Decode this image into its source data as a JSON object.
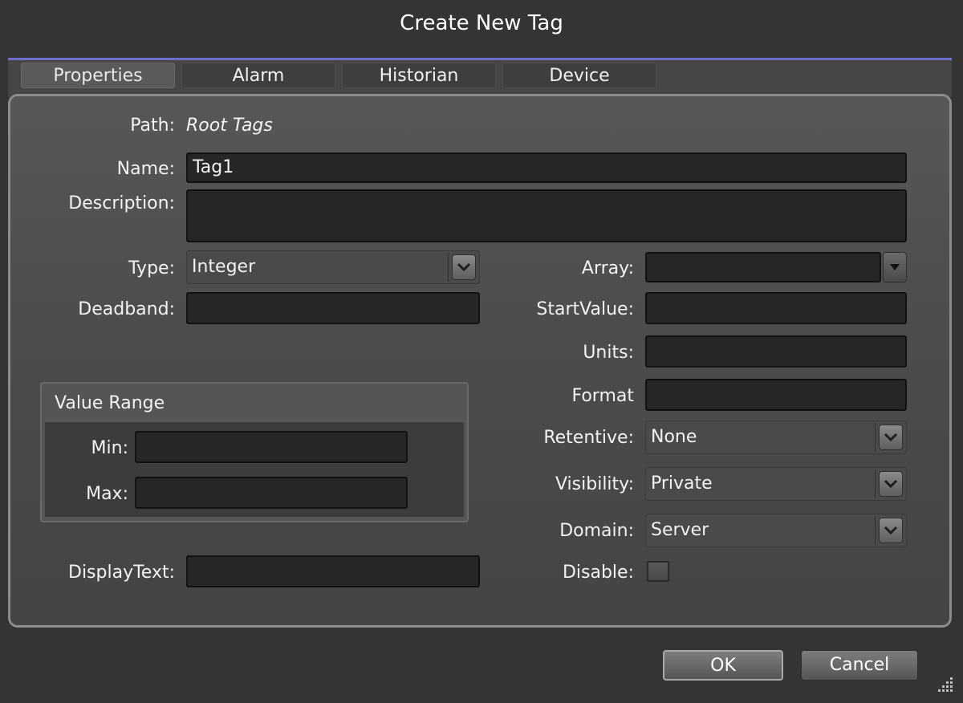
{
  "dialog": {
    "title": "Create New Tag"
  },
  "tabs": [
    "Properties",
    "Alarm",
    "Historian",
    "Device"
  ],
  "path": {
    "label": "Path:",
    "value": "Root Tags"
  },
  "name": {
    "label": "Name:",
    "value": "Tag1"
  },
  "description": {
    "label": "Description:",
    "value": ""
  },
  "type": {
    "label": "Type:",
    "value": "Integer"
  },
  "deadband": {
    "label": "Deadband:",
    "value": ""
  },
  "array": {
    "label": "Array:",
    "value": ""
  },
  "startvalue": {
    "label": "StartValue:",
    "value": ""
  },
  "units": {
    "label": "Units:",
    "value": ""
  },
  "format": {
    "label": "Format",
    "value": ""
  },
  "retentive": {
    "label": "Retentive:",
    "value": "None"
  },
  "visibility": {
    "label": "Visibility:",
    "value": "Private"
  },
  "domain": {
    "label": "Domain:",
    "value": "Server"
  },
  "disable": {
    "label": "Disable:",
    "checked": false
  },
  "value_range": {
    "title": "Value Range",
    "min_label": "Min:",
    "min_value": "",
    "max_label": "Max:",
    "max_value": ""
  },
  "displaytext": {
    "label": "DisplayText:",
    "value": ""
  },
  "buttons": {
    "ok": "OK",
    "cancel": "Cancel"
  },
  "colors": {
    "accent": "#6d6fd0",
    "background": "#343434",
    "input": "#262626"
  },
  "icons": {
    "dropdown": "chevron-down-icon",
    "resize": "resize-grip-icon"
  }
}
